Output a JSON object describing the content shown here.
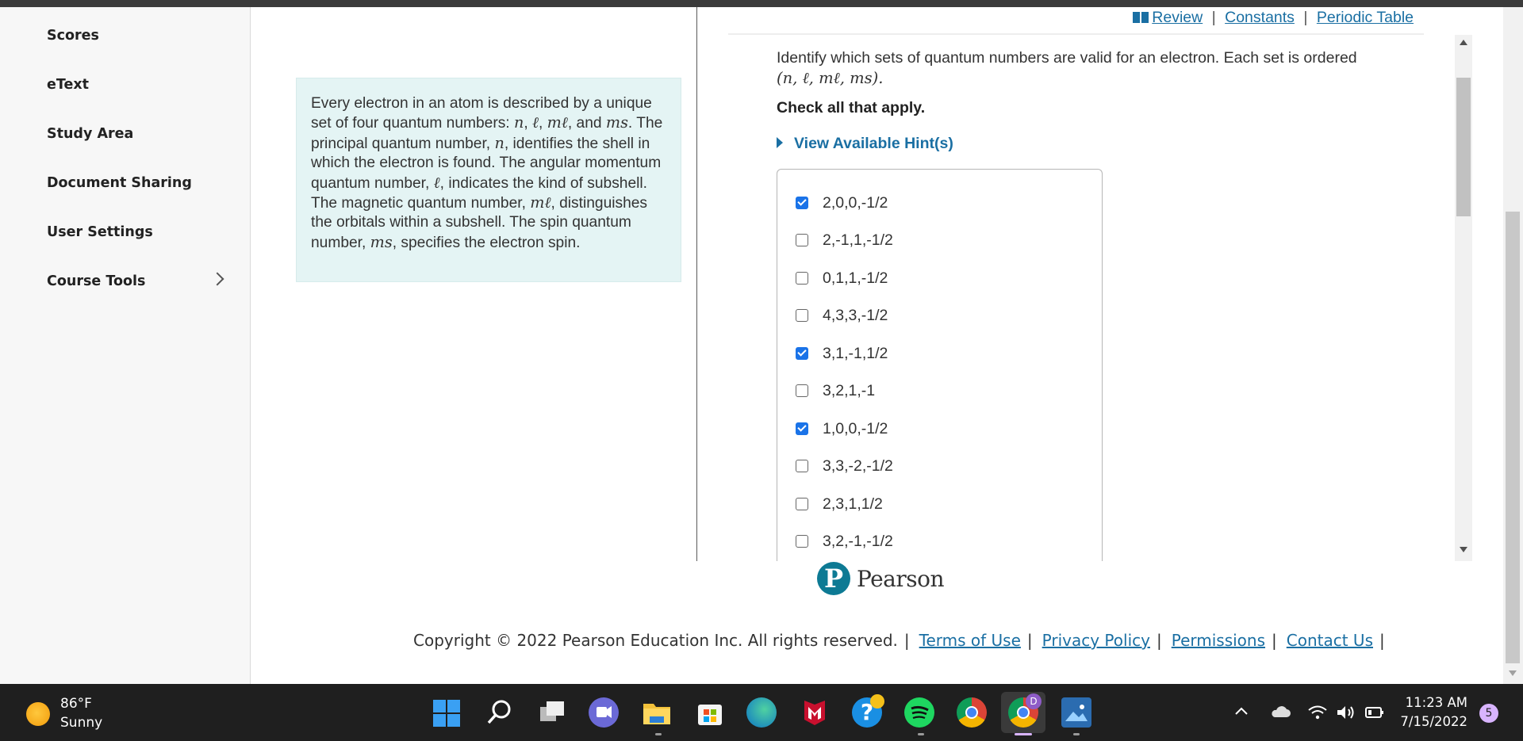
{
  "sidebar": {
    "items": [
      {
        "label": "Scores"
      },
      {
        "label": "eText"
      },
      {
        "label": "Study Area"
      },
      {
        "label": "Document Sharing"
      },
      {
        "label": "User Settings"
      },
      {
        "label": "Course Tools"
      }
    ]
  },
  "intro": {
    "t1": "Every electron in an atom is described by a unique set of four quantum numbers: ",
    "m_n": "n",
    "m_l": "ℓ",
    "m_ml": "mℓ",
    "m_ms": "ms",
    "t2": ", ",
    "t3": ", and ",
    "t4": ". The principal quantum number, ",
    "t5": ", identifies the shell in which the electron is found. The angular momentum quantum number, ",
    "t6": ", indicates the kind of subshell. The magnetic quantum number, ",
    "t7": ", distinguishes the orbitals within a subshell. The spin quantum number, ",
    "t8": ", specifies the electron spin."
  },
  "toplinks": {
    "review": "Review",
    "constants": "Constants",
    "periodic": "Periodic Table",
    "sep": "|"
  },
  "question": {
    "text": "Identify which sets of quantum numbers are valid for an electron. Each set is ordered",
    "tuple": "(n, ℓ, mℓ, ms).",
    "check_all": "Check all that apply.",
    "hint": "View Available Hint(s)"
  },
  "options": [
    {
      "label": "2,0,0,-1/2",
      "checked": true
    },
    {
      "label": "2,-1,1,-1/2",
      "checked": false
    },
    {
      "label": "0,1,1,-1/2",
      "checked": false
    },
    {
      "label": "4,3,3,-1/2",
      "checked": false
    },
    {
      "label": "3,1,-1,1/2",
      "checked": true
    },
    {
      "label": "3,2,1,-1",
      "checked": false
    },
    {
      "label": "1,0,0,-1/2",
      "checked": true
    },
    {
      "label": "3,3,-2,-1/2",
      "checked": false
    },
    {
      "label": "2,3,1,1/2",
      "checked": false
    },
    {
      "label": "3,2,-1,-1/2",
      "checked": false
    }
  ],
  "footer": {
    "brand": "Pearson",
    "logo_letter": "P",
    "copyright": "Copyright © 2022 Pearson Education Inc. All rights reserved.",
    "terms": "Terms of Use",
    "privacy": "Privacy Policy",
    "permissions": "Permissions",
    "contact": "Contact Us",
    "sep": "|"
  },
  "taskbar": {
    "temp": "86°F",
    "condition": "Sunny",
    "time": "11:23 AM",
    "date": "7/15/2022",
    "notifications": "5",
    "chrome_badge": "D",
    "icons": [
      "windows-icon",
      "search-icon",
      "task-view-icon",
      "teams-chat-icon",
      "file-explorer-icon",
      "store-icon",
      "edge-icon",
      "mcafee-icon",
      "help-icon",
      "spotify-icon",
      "chrome-icon",
      "chrome-profile-icon",
      "photos-icon"
    ]
  },
  "colors": {
    "accent": "#1a6fa3",
    "intro_bg": "#e4f4f4",
    "checkbox_on": "#1a73e8",
    "taskbar": "#1f1f1f",
    "pearson": "#0d7a94"
  }
}
